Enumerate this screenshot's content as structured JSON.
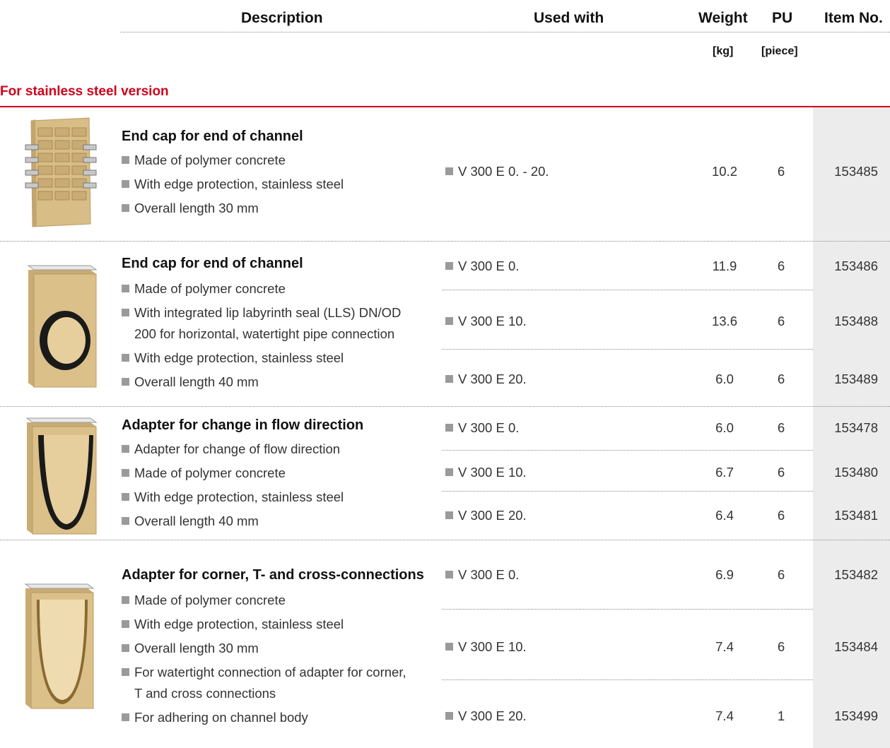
{
  "header": {
    "description": "Description",
    "used_with": "Used with",
    "weight": "Weight",
    "pu": "PU",
    "item_no": "Item No.",
    "weight_unit": "[kg]",
    "pu_unit": "[piece]"
  },
  "section": {
    "title": "For stainless steel version"
  },
  "products": [
    {
      "title": "End cap for end of channel",
      "bullets": [
        "Made of polymer concrete",
        "With edge protection, stainless steel",
        "Overall length 30 mm"
      ],
      "rows": [
        {
          "used_with": "V 300 E 0. - 20.",
          "weight": "10.2",
          "pu": "6",
          "item_no": "153485"
        }
      ]
    },
    {
      "title": "End cap for end of channel",
      "bullets": [
        "Made of polymer concrete",
        "With integrated lip labyrinth seal (LLS) DN/OD",
        "200 for horizontal, watertight pipe connection",
        "With edge protection, stainless steel",
        "Overall length 40 mm"
      ],
      "rows": [
        {
          "used_with": "V 300 E 0.",
          "weight": "11.9",
          "pu": "6",
          "item_no": "153486"
        },
        {
          "used_with": "V 300 E 10.",
          "weight": "13.6",
          "pu": "6",
          "item_no": "153488"
        },
        {
          "used_with": "V 300 E 20.",
          "weight": "6.0",
          "pu": "6",
          "item_no": "153489"
        }
      ]
    },
    {
      "title": "Adapter for change in flow direction",
      "bullets": [
        "Adapter for change of flow direction",
        "Made of polymer concrete",
        "With edge protection, stainless steel",
        "Overall length 40 mm"
      ],
      "rows": [
        {
          "used_with": "V 300 E 0.",
          "weight": "6.0",
          "pu": "6",
          "item_no": "153478"
        },
        {
          "used_with": "V 300 E 10.",
          "weight": "6.7",
          "pu": "6",
          "item_no": "153480"
        },
        {
          "used_with": "V 300 E 20.",
          "weight": "6.4",
          "pu": "6",
          "item_no": "153481"
        }
      ]
    },
    {
      "title": "Adapter for corner, T- and cross-connections",
      "bullets": [
        "Made of polymer concrete",
        "With edge protection, stainless steel",
        "Overall length 30 mm",
        "For watertight connection of adapter for corner,",
        "T and cross connections",
        "For adhering on channel body"
      ],
      "rows": [
        {
          "used_with": "V 300 E 0.",
          "weight": "6.9",
          "pu": "6",
          "item_no": "153482"
        },
        {
          "used_with": "V 300 E 10.",
          "weight": "7.4",
          "pu": "6",
          "item_no": "153484"
        },
        {
          "used_with": "V 300 E 20.",
          "weight": "7.4",
          "pu": "1",
          "item_no": "153499"
        }
      ]
    }
  ],
  "colors": {
    "accent_red": "#d0021b",
    "item_column_shade": "#ececec",
    "product_tan": "#d8bd86"
  }
}
